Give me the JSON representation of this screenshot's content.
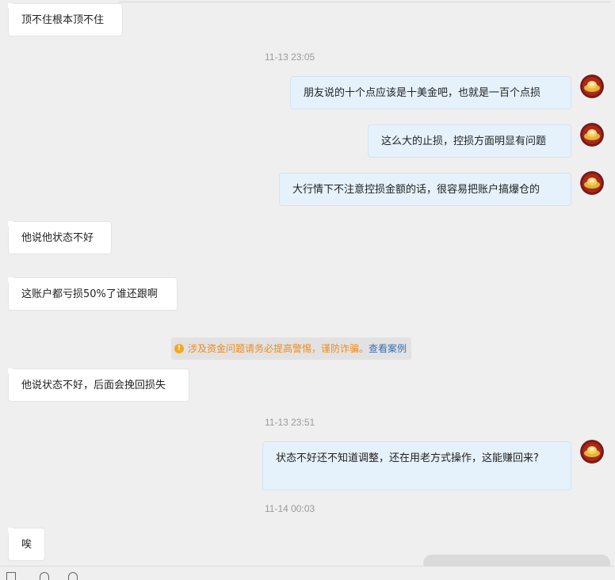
{
  "messages": [
    {
      "side": "left",
      "text": "顶不住根本顶不住"
    },
    {
      "side": "right",
      "text": "朋友说的十个点应该是十美金吧，也就是一百个点损"
    },
    {
      "side": "right",
      "text": "这么大的止损，控损方面明显有问题"
    },
    {
      "side": "right",
      "text": "大行情下不注意控损金额的话，很容易把账户搞爆仓的"
    },
    {
      "side": "left",
      "text": "他说他状态不好"
    },
    {
      "side": "left",
      "text": "这账户都亏损50%了谁还跟啊"
    },
    {
      "side": "left",
      "text": "他说状态不好，后面会挽回损失"
    },
    {
      "side": "right",
      "text": "状态不好还不知道调整，还在用老方式操作，这能赚回来?"
    },
    {
      "side": "left",
      "text": "唉"
    }
  ],
  "timestamps": [
    "11-13 23:05",
    "11-13 23:51",
    "11-14 00:03"
  ],
  "notice": {
    "icon": "warning-icon",
    "text": "涉及资金问题请务必提高警惕，谨防诈骗。",
    "link": "查看案例"
  },
  "colors": {
    "background": "#efefef",
    "left_bubble": "#ffffff",
    "right_bubble": "#e5f1fb",
    "notice_text": "#f08a1a",
    "notice_link": "#3a6fb0",
    "timestamp": "#9a9a9a"
  }
}
